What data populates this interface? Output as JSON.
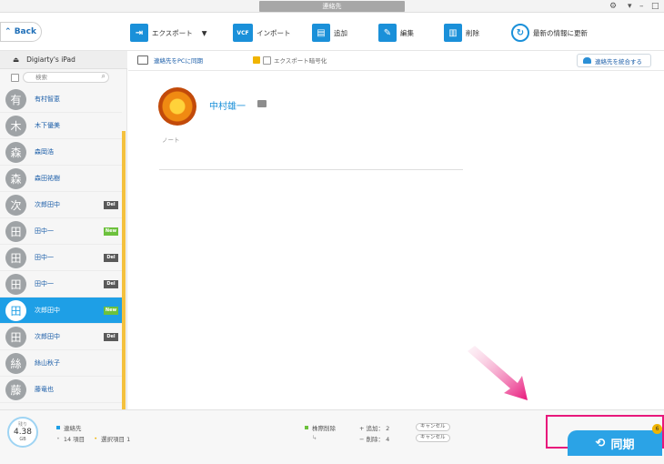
{
  "window": {
    "title": "連絡先"
  },
  "toolbar": {
    "back_label": "Back",
    "export_label": "エクスポート",
    "import_label": "インポート",
    "add_label": "追加",
    "edit_label": "編集",
    "delete_label": "削除",
    "refresh_label": "最新の情報に更新"
  },
  "sidebar": {
    "device_name": "Digiarty's iPad",
    "search_placeholder": "検索",
    "contacts": [
      {
        "avatar": "有",
        "name": "有村智恵",
        "tag": ""
      },
      {
        "avatar": "木",
        "name": "木下優美",
        "tag": ""
      },
      {
        "avatar": "森",
        "name": "森岡浩",
        "tag": ""
      },
      {
        "avatar": "森",
        "name": "森田祐樹",
        "tag": ""
      },
      {
        "avatar": "次",
        "name": "次郎田中",
        "tag": "Del"
      },
      {
        "avatar": "田",
        "name": "田中一",
        "tag": "New"
      },
      {
        "avatar": "田",
        "name": "田中一",
        "tag": "Del"
      },
      {
        "avatar": "田",
        "name": "田中一",
        "tag": "Del"
      },
      {
        "avatar": "田",
        "name": "次郎田中",
        "tag": "New",
        "active": true
      },
      {
        "avatar": "田",
        "name": "次郎田中",
        "tag": "Del"
      },
      {
        "avatar": "絲",
        "name": "絲山秋子",
        "tag": ""
      },
      {
        "avatar": "藤",
        "name": "藤竜也",
        "tag": ""
      }
    ]
  },
  "main": {
    "sync_pc_label": "連絡先をPCに同期",
    "encrypt_label": "エクスポート暗号化",
    "merge_label": "連絡先を統合する",
    "contact_name": "中村雄一",
    "note_label": "ノート"
  },
  "bottom": {
    "storage_label": "残り",
    "storage_value": "4.38",
    "storage_unit": "GB",
    "contacts_label": "連絡先",
    "items_count": "14 項目",
    "selected_items": "選択項目 1",
    "pending_label": "株際削除",
    "added_label": "+ 追加： 2",
    "deleted_label": "− 削除： 4",
    "cancel_label": "キャンセル",
    "sync_label": "同期",
    "sync_badge": "6"
  },
  "colors": {
    "accent": "#1e9fe6",
    "tag_new": "#6cc13c",
    "tag_del": "#5a5a5a",
    "highlight_box": "#e8177b",
    "scroll": "#f4c13f"
  }
}
